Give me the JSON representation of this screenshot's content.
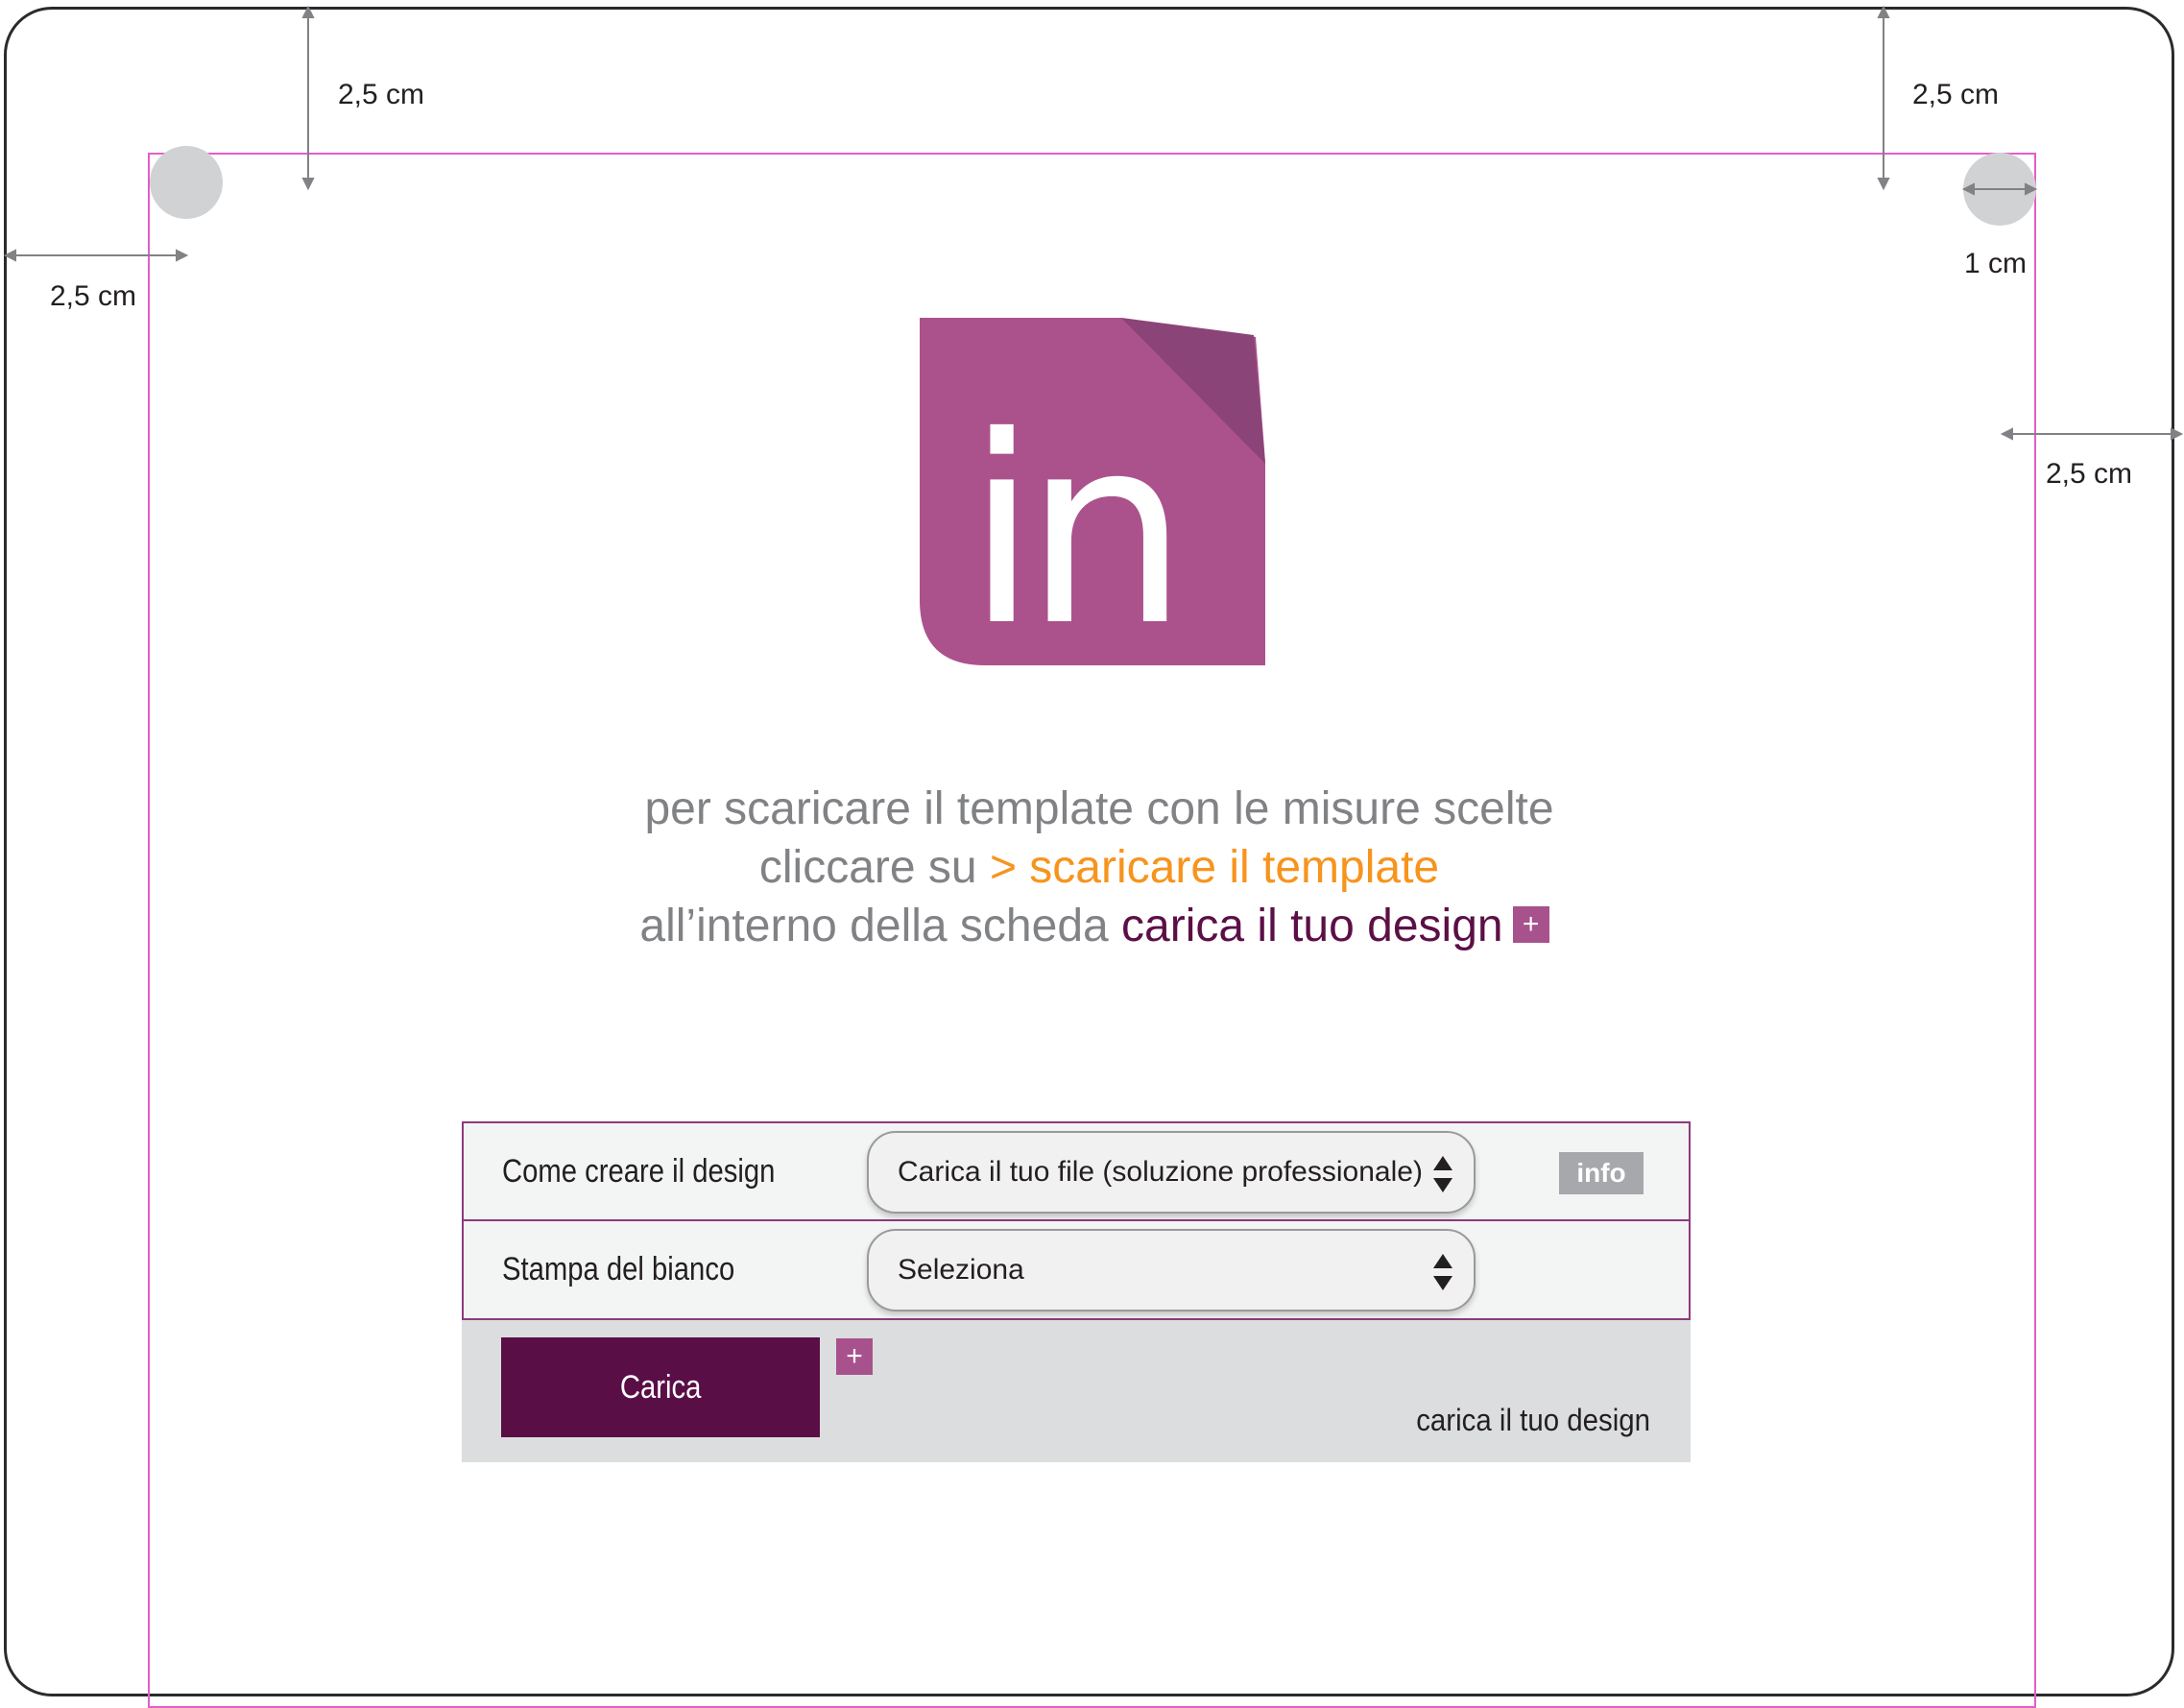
{
  "dimensions": {
    "top_left_margin": "2,5 cm",
    "top_right_margin": "2,5 cm",
    "left_margin": "2,5 cm",
    "right_margin": "2,5 cm",
    "hole_size": "1 cm"
  },
  "logo": {
    "text": "in",
    "color": "#ab528c",
    "fold_color": "#8b4477"
  },
  "instructions": {
    "line1": "per scaricare il template con le misure scelte",
    "line2_prefix": "cliccare su ",
    "line2_link": "> scaricare il template",
    "line3_prefix": "all’interno della scheda ",
    "line3_highlight": "carica il tuo design",
    "plus_icon": "+"
  },
  "form": {
    "rows": [
      {
        "label": "Come creare il design",
        "value": "Carica il tuo file (soluzione professionale)",
        "info_label": "info"
      },
      {
        "label": "Stampa del bianco",
        "value": "Seleziona"
      }
    ],
    "upload": {
      "button_label": "Carica",
      "plus_icon": "+",
      "caption": "carica il tuo design"
    }
  },
  "colors": {
    "trim_line": "#e35fc9",
    "orange_link": "#f7941d",
    "plum": "#5c0f46",
    "badge": "#a7528c"
  }
}
